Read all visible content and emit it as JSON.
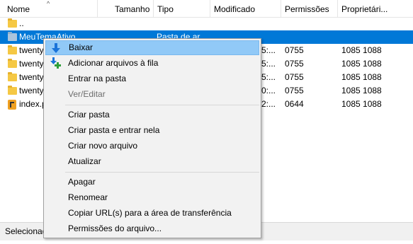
{
  "columns": {
    "name": "Nome",
    "size": "Tamanho",
    "type": "Tipo",
    "modified": "Modificado",
    "permissions": "Permissões",
    "owner": "Proprietári..."
  },
  "rows": [
    {
      "name": "..",
      "modified": "",
      "permissions": "",
      "owner": "",
      "icon": "folder-icon"
    },
    {
      "name": "MeuTemaAtivo",
      "type": "Pasta de ar",
      "modified": "",
      "permissions": "",
      "owner": "",
      "icon": "folder-icon",
      "selected": true
    },
    {
      "name": "twenty",
      "modified": "5:...",
      "permissions": "0755",
      "owner": "1085 1088",
      "icon": "folder-icon"
    },
    {
      "name": "twenty",
      "modified": "5:...",
      "permissions": "0755",
      "owner": "1085 1088",
      "icon": "folder-icon"
    },
    {
      "name": "twenty",
      "modified": "5:...",
      "permissions": "0755",
      "owner": "1085 1088",
      "icon": "folder-icon"
    },
    {
      "name": "twenty",
      "modified": "0:...",
      "permissions": "0755",
      "owner": "1085 1088",
      "icon": "folder-icon"
    },
    {
      "name": "index.p",
      "modified": "2:...",
      "permissions": "0644",
      "owner": "1085 1088",
      "icon": "php-file-icon"
    }
  ],
  "status": "Selecionad",
  "context_menu": {
    "download": "Baixar",
    "add_to_queue": "Adicionar arquivos à fila",
    "enter_folder": "Entrar na pasta",
    "view_edit": "Ver/Editar",
    "create_folder": "Criar pasta",
    "create_enter_folder": "Criar pasta e entrar nela",
    "create_file": "Criar novo arquivo",
    "refresh": "Atualizar",
    "delete": "Apagar",
    "rename": "Renomear",
    "copy_urls": "Copiar URL(s) para a área de transferência",
    "file_permissions": "Permissões do arquivo..."
  },
  "colors": {
    "selection": "#0078d7",
    "menu_highlight": "#91c9f7",
    "download_arrow": "#1a73d9",
    "add_plus": "#2e9e3a"
  }
}
